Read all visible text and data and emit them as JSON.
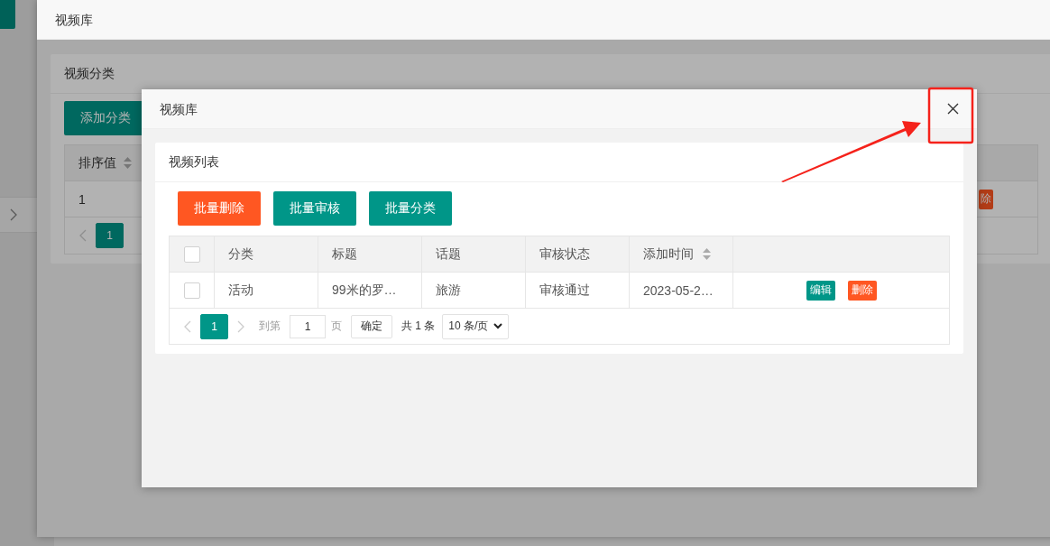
{
  "outer_dialog": {
    "title": "视频库",
    "card": {
      "title": "视频分类",
      "add_button": "添加分类",
      "table": {
        "columns": [
          {
            "label": "排序值",
            "sortable": true
          }
        ],
        "rows": [
          {
            "cells": [
              "1"
            ],
            "actions": [
              {
                "label": "除",
                "kind": "danger"
              }
            ]
          }
        ]
      },
      "pagination": {
        "prev_disabled": true,
        "pages": [
          {
            "label": "1",
            "selected": true
          }
        ]
      }
    }
  },
  "inner_dialog": {
    "title": "视频库",
    "card": {
      "title": "视频列表",
      "toolbar": [
        {
          "label": "批量删除",
          "kind": "danger"
        },
        {
          "label": "批量审核",
          "kind": "primary"
        },
        {
          "label": "批量分类",
          "kind": "primary"
        }
      ],
      "table": {
        "select_all_checked": false,
        "columns": [
          {
            "label": "分类",
            "sortable": false
          },
          {
            "label": "标题",
            "sortable": false
          },
          {
            "label": "话题",
            "sortable": false
          },
          {
            "label": "审核状态",
            "sortable": false
          },
          {
            "label": "添加时间",
            "sortable": true
          }
        ],
        "rows": [
          {
            "checked": false,
            "cells": [
              "活动",
              "99米的罗…",
              "旅游",
              "审核通过",
              "2023-05-2…"
            ],
            "actions": [
              {
                "label": "编辑",
                "kind": "primary"
              },
              {
                "label": "删除",
                "kind": "danger"
              }
            ]
          }
        ]
      },
      "pagination": {
        "prev_disabled": true,
        "next_disabled": true,
        "pages": [
          {
            "label": "1",
            "selected": true
          }
        ],
        "goto_label": "到第",
        "goto_value": "1",
        "page_unit": "页",
        "confirm": "确定",
        "total": "共 1 条",
        "page_size": "10 条/页"
      }
    }
  }
}
